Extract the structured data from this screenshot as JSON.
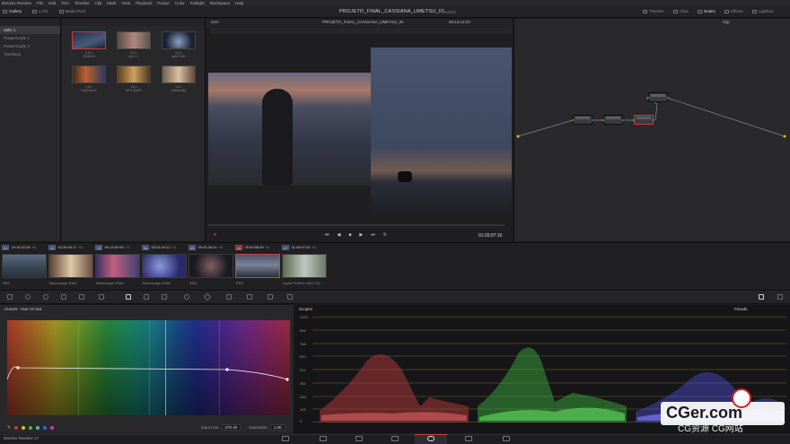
{
  "app": {
    "menu": [
      "DaVinci Resolve",
      "File",
      "Edit",
      "Trim",
      "Timeline",
      "Clip",
      "Mark",
      "View",
      "Playback",
      "Fusion",
      "Color",
      "Fairlight",
      "Workspace",
      "Help"
    ],
    "project_title": "PROJETO_FINAL_CASSIANA_UMETSU_01",
    "edited": "Edited",
    "version": "DaVinci Resolve 17"
  },
  "toolbar": {
    "left": [
      "Gallery",
      "LUTs",
      "Media Pool"
    ],
    "right": [
      "Timeline",
      "Clips",
      "Nodes",
      "Effects",
      "Lightbox"
    ]
  },
  "gallery": {
    "albums": [
      "Stills 1",
      "PowerGrade 1",
      "PowerGrade 2",
      "Timelines"
    ],
    "stills": [
      {
        "l1": "1.5.1",
        "l2": "23:55:39"
      },
      {
        "l1": "1.3.1",
        "l2": "4L8.1.1"
      },
      {
        "l1": "1.3.1",
        "l2": "jk4LTL8X"
      },
      {
        "l1": "1.5.1",
        "l2": "KQ6S3L4K"
      },
      {
        "l1": "1.5.1",
        "l2": "9PO7Q1P0"
      },
      {
        "l1": "1.5.1",
        "l2": "Hd0vbx6Q"
      }
    ]
  },
  "viewer": {
    "zoom": "63%",
    "timecode_top": "05:13:13:23",
    "timecode_bottom": "01:03:07:10",
    "node_mode": "Clip"
  },
  "timeline_clips": [
    {
      "num": "01",
      "tc": "19:15:22:25",
      "track": "V1",
      "label": "RED"
    },
    {
      "num": "02",
      "tc": "02:39:09:17",
      "track": "V1",
      "label": "Blackmagic RAW"
    },
    {
      "num": "03",
      "tc": "06:13:52:08",
      "track": "V1",
      "label": "Blackmagic RAW"
    },
    {
      "num": "04",
      "tc": "05:23:19:13",
      "track": "V1",
      "label": "Blackmagic RAW"
    },
    {
      "num": "05",
      "tc": "05:20:28:24",
      "track": "V1",
      "label": "RED"
    },
    {
      "num": "06",
      "tc": "09:09:56:09",
      "track": "V1",
      "label": "RED"
    },
    {
      "num": "07",
      "tc": "01:48:07:04",
      "track": "V1",
      "label": "Apple ProRes 4444 XQ"
    }
  ],
  "curves": {
    "title": "Curves - Hue Vs Sat",
    "input_hue_label": "Input Hue",
    "input_hue_value": "270.40",
    "saturation_label": "Saturation",
    "saturation_value": "1.00",
    "swatch_colors": [
      "#e03030",
      "#e0c030",
      "#40c040",
      "#40c0c0",
      "#4060e0",
      "#c040c0"
    ]
  },
  "scopes": {
    "title": "Scopes",
    "mode": "Parade",
    "scale": [
      "1023",
      "896",
      "768",
      "640",
      "512",
      "384",
      "256",
      "128",
      "0"
    ]
  },
  "watermark": {
    "main": "CGer.com",
    "sub": "CG资源 CG网站"
  },
  "colors": {
    "accent_red": "#c43a3a",
    "node_green": "#2ec444",
    "node_blue": "#2e8fdc"
  }
}
